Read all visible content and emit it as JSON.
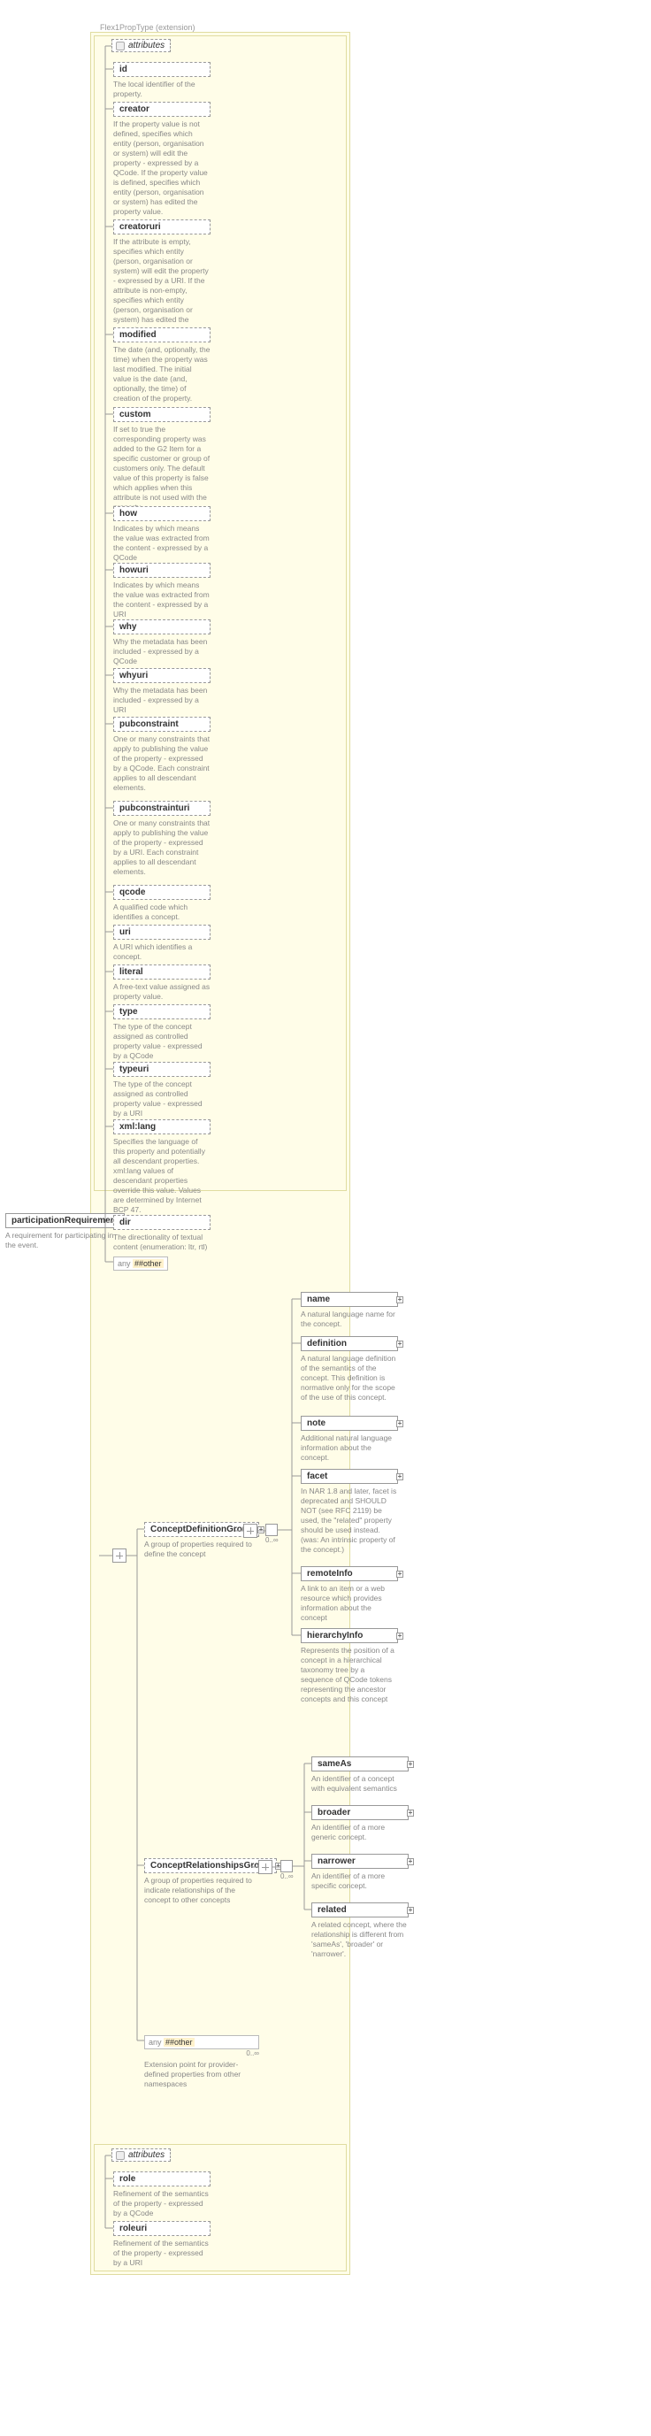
{
  "extension": {
    "title": "Flex1PropType (extension)"
  },
  "root": {
    "name": "participationRequirement",
    "desc": "A requirement for participating in the event."
  },
  "attrLabel": "attributes",
  "any": {
    "label_any": "any",
    "ns": "##other",
    "card": "0..∞",
    "desc": "Extension point for provider-defined properties from other namespaces"
  },
  "attrs1": [
    {
      "n": "id",
      "d": "The local identifier of the property."
    },
    {
      "n": "creator",
      "d": "If the property value is not defined, specifies which entity (person, organisation or system) will edit the property - expressed by a QCode. If the property value is defined, specifies which entity (person, organisation or system) has edited the property value."
    },
    {
      "n": "creatoruri",
      "d": "If the attribute is empty, specifies which entity (person, organisation or system) will edit the property - expressed by a URI. If the attribute is non-empty, specifies which entity (person, organisation or system) has edited the property."
    },
    {
      "n": "modified",
      "d": "The date (and, optionally, the time) when the property was last modified. The initial value is the date (and, optionally, the time) of creation of the property."
    },
    {
      "n": "custom",
      "d": "If set to true the corresponding property was added to the G2 Item for a specific customer or group of customers only. The default value of this property is false which applies when this attribute is not used with the property."
    },
    {
      "n": "how",
      "d": "Indicates by which means the value was extracted from the content - expressed by a QCode"
    },
    {
      "n": "howuri",
      "d": "Indicates by which means the value was extracted from the content - expressed by a URI"
    },
    {
      "n": "why",
      "d": "Why the metadata has been included - expressed by a QCode"
    },
    {
      "n": "whyuri",
      "d": "Why the metadata has been included - expressed by a URI"
    },
    {
      "n": "pubconstraint",
      "d": "One or many constraints that apply to publishing the value of the property - expressed by a QCode. Each constraint applies to all descendant elements."
    },
    {
      "n": "pubconstrainturi",
      "d": "One or many constraints that apply to publishing the value of the property - expressed by a URI. Each constraint applies to all descendant elements."
    },
    {
      "n": "qcode",
      "d": "A qualified code which identifies a concept."
    },
    {
      "n": "uri",
      "d": "A URI which identifies a concept."
    },
    {
      "n": "literal",
      "d": "A free-text value assigned as property value."
    },
    {
      "n": "type",
      "d": "The type of the concept assigned as controlled property value - expressed by a QCode"
    },
    {
      "n": "typeuri",
      "d": "The type of the concept assigned as controlled property value - expressed by a URI"
    },
    {
      "n": "xml:lang",
      "d": "Specifies the language of this property and potentially all descendant properties. xml:lang values of descendant properties override this value. Values are determined by Internet BCP 47."
    },
    {
      "n": "dir",
      "d": "The directionality of textual content (enumeration: ltr, rtl)"
    }
  ],
  "groups": {
    "cdg": {
      "n": "ConceptDefinitionGroup",
      "d": "A group of properties required to define the concept",
      "card": "0..∞"
    },
    "crg": {
      "n": "ConceptRelationshipsGroup",
      "d": "A group of properties required to indicate relationships of the concept to other concepts",
      "card": "0..∞"
    }
  },
  "cdgItems": [
    {
      "n": "name",
      "d": "A natural language name for the concept."
    },
    {
      "n": "definition",
      "d": "A natural language definition of the semantics of the concept. This definition is normative only for the scope of the use of this concept."
    },
    {
      "n": "note",
      "d": "Additional natural language information about the concept."
    },
    {
      "n": "facet",
      "d": "In NAR 1.8 and later, facet is deprecated and SHOULD NOT (see RFC 2119) be used, the \"related\" property should be used instead.(was: An intrinsic property of the concept.)"
    },
    {
      "n": "remoteInfo",
      "d": "A link to an item or a web resource which provides information about the concept"
    },
    {
      "n": "hierarchyInfo",
      "d": "Represents the position of a concept in a hierarchical taxonomy tree by a sequence of QCode tokens representing the ancestor concepts and this concept"
    }
  ],
  "crgItems": [
    {
      "n": "sameAs",
      "d": "An identifier of a concept with equivalent semantics"
    },
    {
      "n": "broader",
      "d": "An identifier of a more generic concept."
    },
    {
      "n": "narrower",
      "d": "An identifier of a more specific concept."
    },
    {
      "n": "related",
      "d": "A related concept, where the relationship is different from 'sameAs', 'broader' or 'narrower'."
    }
  ],
  "attrs2": [
    {
      "n": "role",
      "d": "Refinement of the semantics of the property - expressed by a QCode"
    },
    {
      "n": "roleuri",
      "d": "Refinement of the semantics of the property - expressed by a URI"
    }
  ]
}
